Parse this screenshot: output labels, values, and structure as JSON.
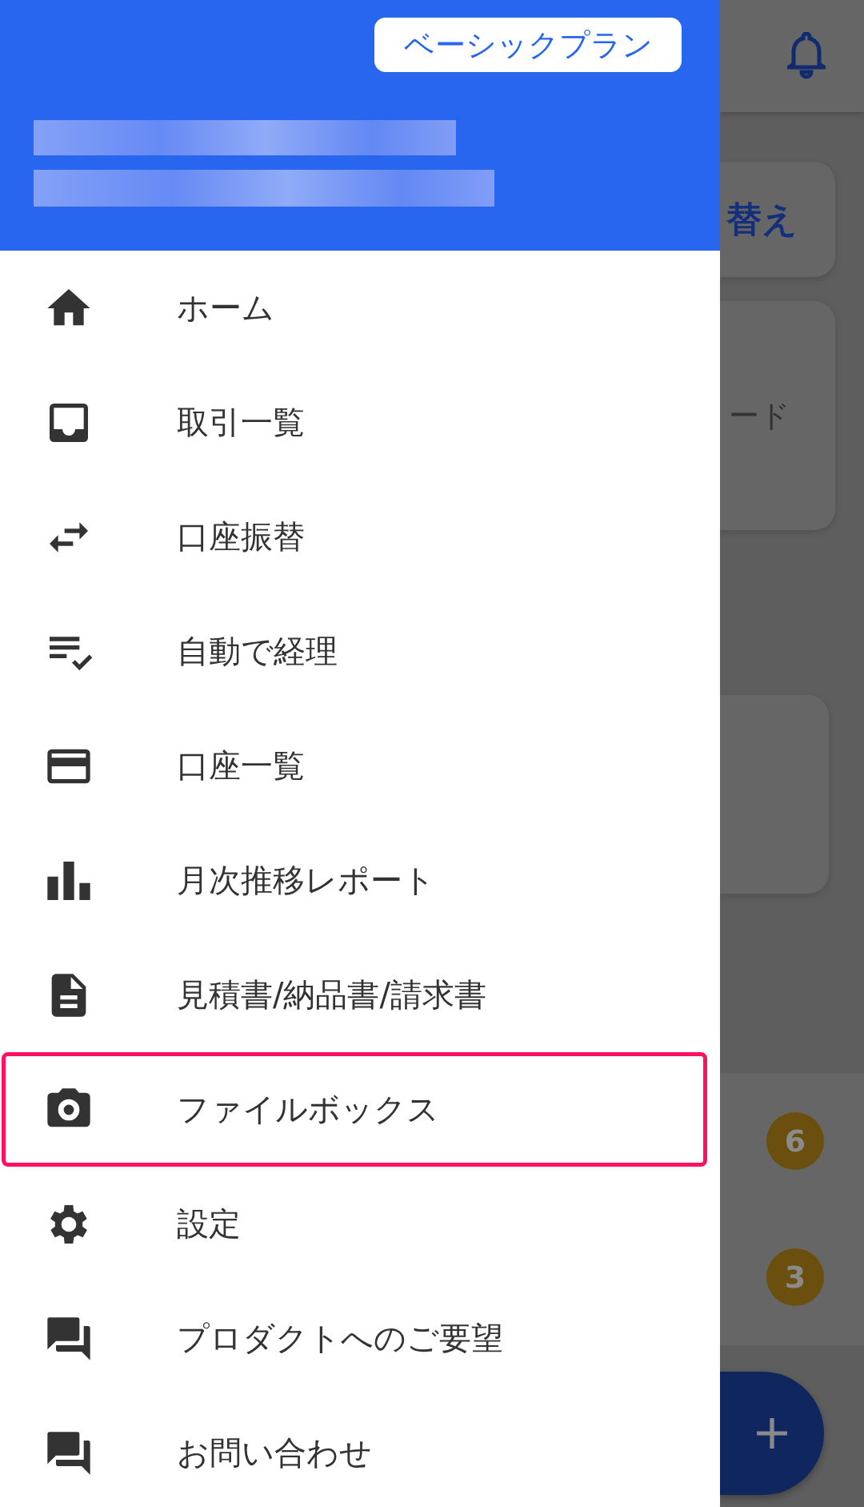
{
  "background_app": {
    "card_1_text": "替え",
    "card_2_text": "ード",
    "badges": [
      "6",
      "3"
    ]
  },
  "drawer": {
    "plan_badge": "ベーシックプラン",
    "items": [
      {
        "kind": "home",
        "label": "ホーム",
        "highlighted": false
      },
      {
        "kind": "inbox",
        "label": "取引一覧",
        "highlighted": false
      },
      {
        "kind": "transfer",
        "label": "口座振替",
        "highlighted": false
      },
      {
        "kind": "checklist",
        "label": "自動で経理",
        "highlighted": false
      },
      {
        "kind": "card",
        "label": "口座一覧",
        "highlighted": false
      },
      {
        "kind": "chart",
        "label": "月次推移レポート",
        "highlighted": false
      },
      {
        "kind": "document",
        "label": "見積書/納品書/請求書",
        "highlighted": false
      },
      {
        "kind": "camera",
        "label": "ファイルボックス",
        "highlighted": true
      },
      {
        "kind": "gear",
        "label": "設定",
        "highlighted": false
      },
      {
        "kind": "chat",
        "label": "プロダクトへのご要望",
        "highlighted": false
      },
      {
        "kind": "chat",
        "label": "お問い合わせ",
        "highlighted": false
      }
    ]
  }
}
